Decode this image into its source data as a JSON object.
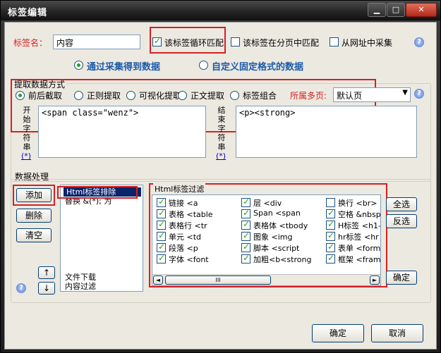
{
  "window": {
    "title": "标签编辑",
    "minimize": "▁",
    "maximize": "□",
    "close": "✕"
  },
  "tagname": {
    "label": "标签名：",
    "value": "内容"
  },
  "options": {
    "loop_match": "该标签循环匹配",
    "page_match": "该标签在分页中匹配",
    "from_url": "从网址中采集"
  },
  "source": {
    "collect": "通过采集得到数据",
    "custom": "自定义固定格式的数据"
  },
  "extract": {
    "group_title": "提取数据方式",
    "methods": [
      "前后截取",
      "正则提取",
      "可视化提取",
      "正文提取",
      "标签组合"
    ],
    "page_label": "所属多页:",
    "page_value": "默认页",
    "start_label": [
      "开",
      "始",
      "字",
      "符",
      "串"
    ],
    "end_label": [
      "结",
      "束",
      "字",
      "符",
      "串"
    ],
    "star": "(*)",
    "start_value": "<span class=\"wenz\">",
    "end_value": "<p><strong>"
  },
  "processing": {
    "group_title": "数据处理",
    "add": "添加",
    "delete": "删除",
    "clear": "清空",
    "up": "↑",
    "down": "↓",
    "list_top": [
      "Html标签排除",
      "替换 &(*); 为"
    ],
    "list_bottom": [
      "文件下载",
      "内容过滤"
    ]
  },
  "html_filter": {
    "title": "Html标签过滤",
    "items": [
      [
        "链接 <a",
        "层 <div",
        "换行 <br>"
      ],
      [
        "表格 <table",
        "Span <span",
        "空格 &nbsp"
      ],
      [
        "表格行 <tr",
        "表格体 <tbody",
        "H标签 <h1-"
      ],
      [
        "单元 <td",
        "图象 <img",
        "hr标签 <hr"
      ],
      [
        "段落 <p",
        "脚本 <script",
        "表单 <form"
      ],
      [
        "字体 <font",
        "加粗<b<strong",
        "框架 <fram"
      ]
    ],
    "unchecked": [
      "换行 <br>"
    ],
    "select_all": "全选",
    "invert": "反选",
    "confirm": "确定",
    "scroll_left": "◄",
    "scroll_right": "►",
    "scroll_thumb": "III"
  },
  "footer": {
    "ok": "确定",
    "cancel": "取消"
  }
}
